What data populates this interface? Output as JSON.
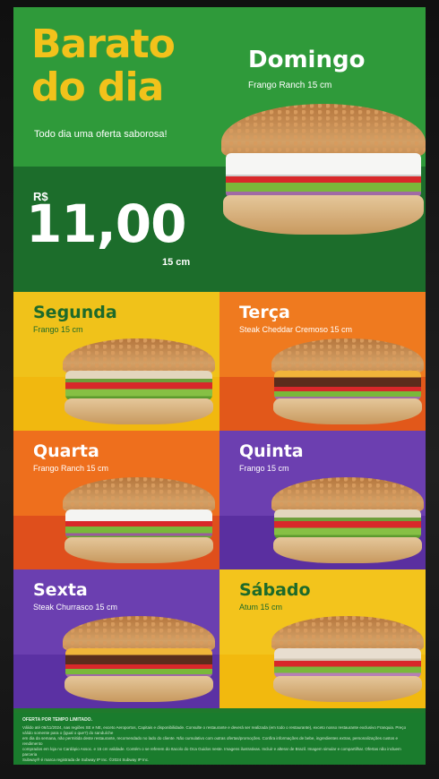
{
  "hero": {
    "title_line1": "Barato",
    "title_line2": "do dia",
    "tagline": "Todo dia uma oferta saborosa!",
    "day": "Domingo",
    "day_item": "Frango Ranch 15 cm",
    "currency": "R$",
    "price": "11,00",
    "size": "15 cm"
  },
  "days": [
    {
      "name": "Segunda",
      "item": "Frango 15 cm",
      "bg": "#f0c21a",
      "bar": "#f1b80f",
      "text": "#1d6a2a",
      "sub_color": "#1d6a2a",
      "filling": "chicken"
    },
    {
      "name": "Terça",
      "item": "Steak Cheddar Cremoso 15 cm",
      "bg": "#ef7a1f",
      "bar": "#e2581a",
      "text": "#ffffff",
      "sub_color": "#ffffff",
      "filling": "steak"
    },
    {
      "name": "Quarta",
      "item": "Frango Ranch 15 cm",
      "bg": "#ee6f1d",
      "bar": "#df4f1c",
      "text": "#ffffff",
      "sub_color": "#ffffff",
      "filling": "ranch"
    },
    {
      "name": "Quinta",
      "item": "Frango 15 cm",
      "bg": "#6c3fb0",
      "bar": "#5a2fa0",
      "text": "#ffffff",
      "sub_color": "#ffffff",
      "filling": "chicken"
    },
    {
      "name": "Sexta",
      "item": "Steak Churrasco 15 cm",
      "bg": "#6b3fb0",
      "bar": "#5b31a3",
      "text": "#ffffff",
      "sub_color": "#ffffff",
      "filling": "steak"
    },
    {
      "name": "Sábado",
      "item": "Atum 15 cm",
      "bg": "#f3c41c",
      "bar": "#f2b90e",
      "text": "#1d6a2a",
      "sub_color": "#1d6a2a",
      "filling": "tuna"
    }
  ],
  "footer": {
    "heading": "OFERTA POR TEMPO LIMITADO.",
    "lines": [
      "Válido até 06/11/2024, nas regiões SE e NE, exceto Aeroportos, Capitais e disponibilidade. Consulte o restaurante e deverá ser realizada (em todo o restaurante), exceto nosso restaurante exclusivo Franquia. Preço válido somente para o (igual o que?) do sanduíche",
      "em dia da semana, não permitida deste restaurante, recomendado no lado do cliente. Não cumulativo com outras ofertas/promoções. Confira informações de bebe, ingredientes extras, personalizações custos e rendimento",
      "comprados em loja no Cardápio Assoc. e 15 cm validade. Contém o se referem do Itacolo do Oca Guidos neste. Imagens ilustrativas. Incluir e alterar de Brazil. Imagem simular e compartilhar. Ofertas não incluem parceria",
      "Subway® é marca registrada de Subway IP Inc. ©2024 Subway IP Inc."
    ]
  },
  "colors": {
    "hero_top": "#2f9a3a",
    "hero_bottom": "#1c6d2b",
    "title": "#f2c21b",
    "footer": "#1a7c2d"
  }
}
